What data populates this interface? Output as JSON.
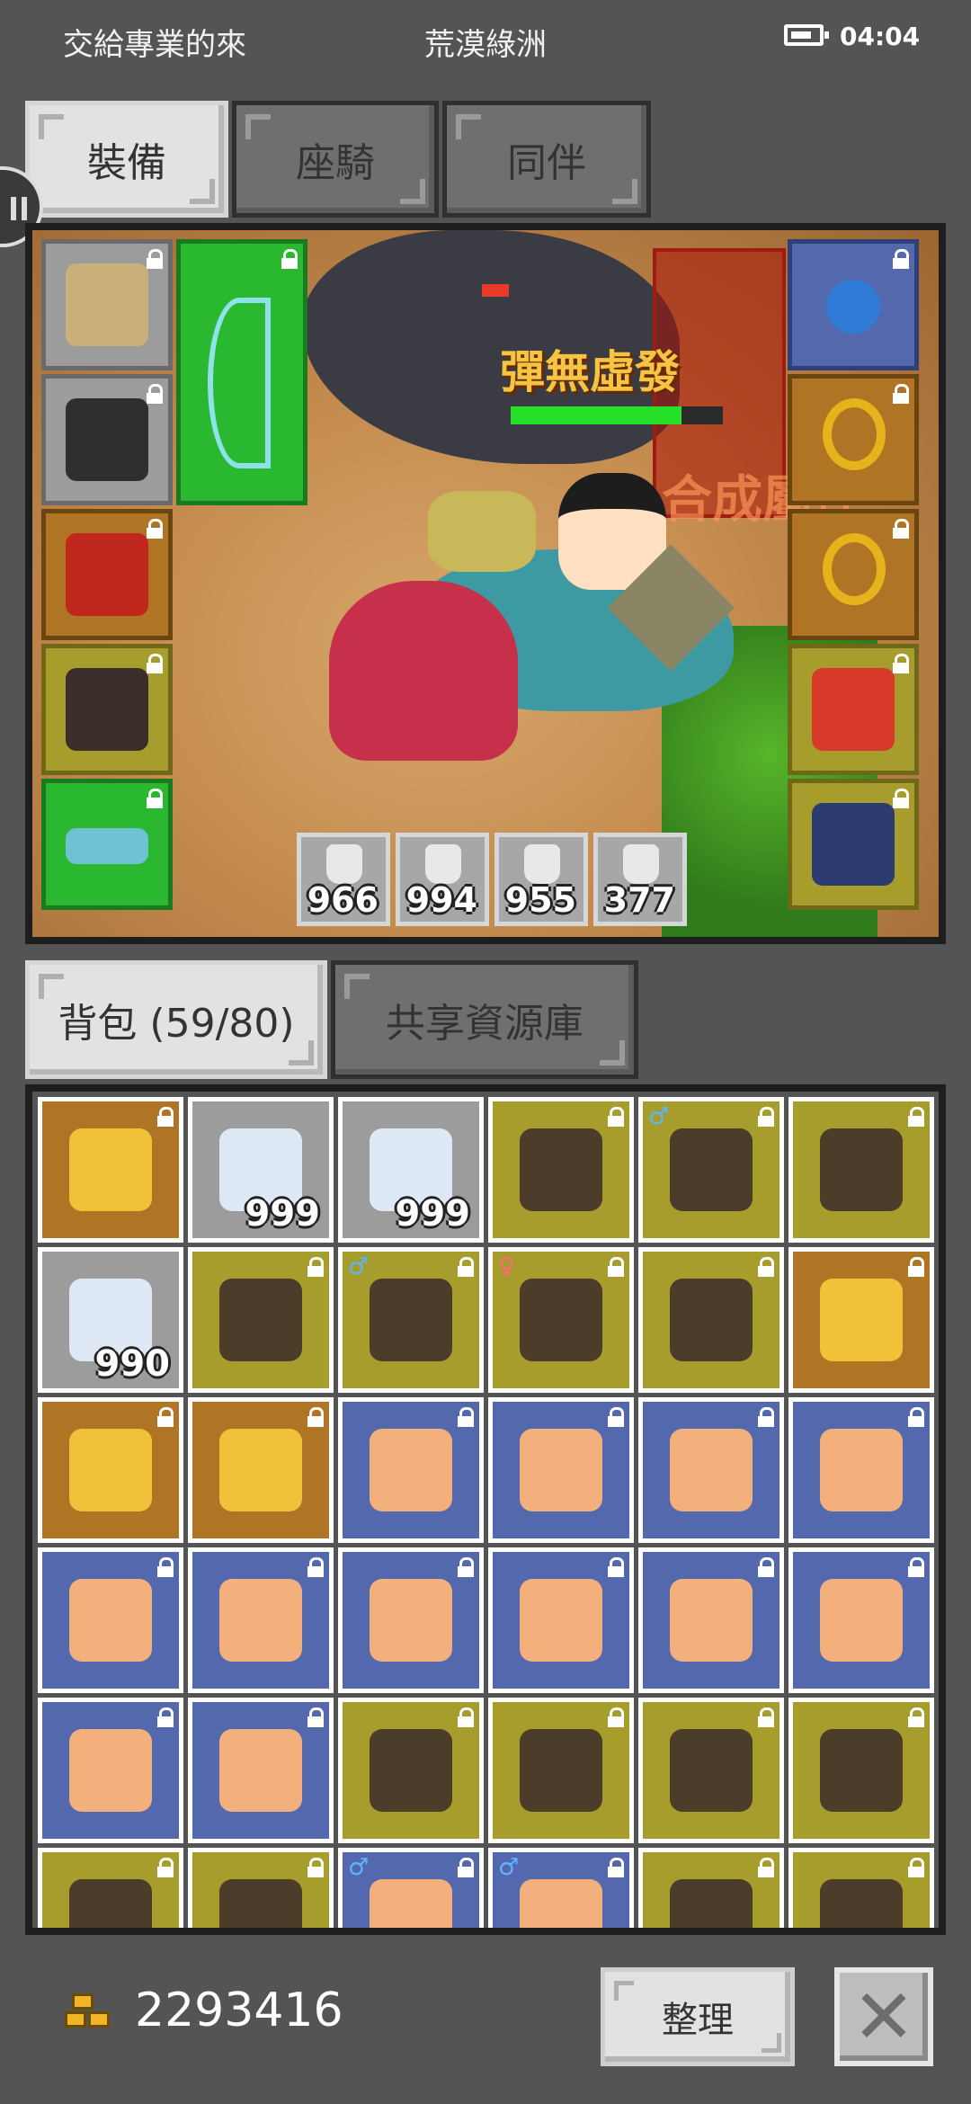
{
  "status_bar": {
    "left_text": "交給專業的來",
    "center_text": "荒漠綠洲",
    "time": "04:04"
  },
  "top_tabs": [
    "裝備",
    "座騎",
    "同伴"
  ],
  "scene": {
    "skill_text": "彈無虛發",
    "fuse_text": "合成屬性"
  },
  "potions": [
    "966",
    "994",
    "955",
    "377"
  ],
  "bag_tabs": [
    "背包 (59/80)",
    "共享資源庫"
  ],
  "bag_items": [
    [
      {
        "c": "brown"
      },
      {
        "c": "gray",
        "n": "999"
      },
      {
        "c": "gray",
        "n": "999"
      },
      {
        "c": "olive"
      },
      {
        "c": "olive",
        "egg": "♂"
      },
      {
        "c": "olive"
      }
    ],
    [
      {
        "c": "gray",
        "n": "990"
      },
      {
        "c": "olive"
      },
      {
        "c": "olive",
        "egg": "♂"
      },
      {
        "c": "olive",
        "egg": "♀"
      },
      {
        "c": "olive"
      },
      {
        "c": "brown"
      }
    ],
    [
      {
        "c": "brown"
      },
      {
        "c": "brown"
      },
      {
        "c": "blue"
      },
      {
        "c": "blue"
      },
      {
        "c": "blue"
      },
      {
        "c": "blue"
      }
    ],
    [
      {
        "c": "blue"
      },
      {
        "c": "blue"
      },
      {
        "c": "blue"
      },
      {
        "c": "blue"
      },
      {
        "c": "blue"
      },
      {
        "c": "blue"
      }
    ],
    [
      {
        "c": "blue"
      },
      {
        "c": "blue"
      },
      {
        "c": "olive"
      },
      {
        "c": "olive"
      },
      {
        "c": "olive"
      },
      {
        "c": "olive"
      }
    ],
    [
      {
        "c": "olive"
      },
      {
        "c": "olive"
      },
      {
        "c": "blue",
        "egg": "♂"
      },
      {
        "c": "blue",
        "egg": "♂"
      },
      {
        "c": "olive"
      },
      {
        "c": "olive"
      }
    ]
  ],
  "gold": "2293416",
  "sort_label": "整理",
  "close_label": "✕"
}
